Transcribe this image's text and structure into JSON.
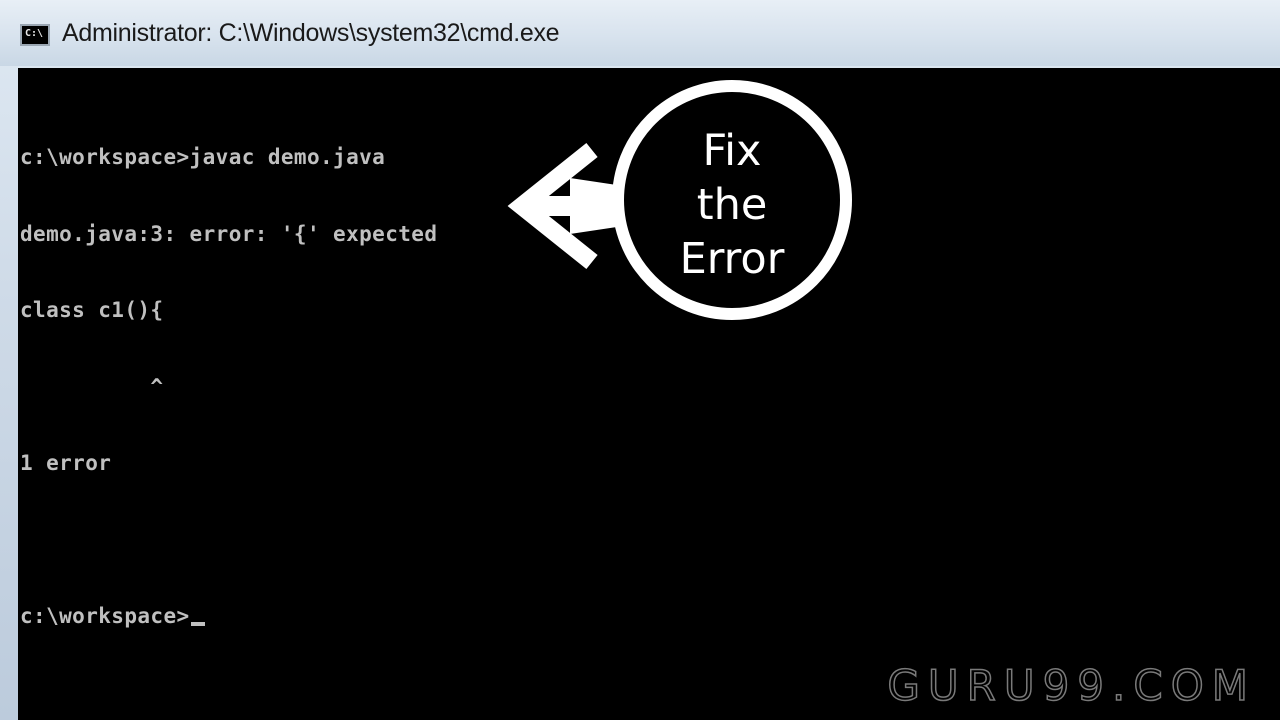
{
  "window": {
    "title": "Administrator: C:\\Windows\\system32\\cmd.exe",
    "icon": "cmd-icon",
    "icon_label": "C:\\"
  },
  "console": {
    "lines": [
      "c:\\workspace>javac demo.java",
      "demo.java:3: error: '{' expected",
      "class c1(){",
      "          ^",
      "1 error",
      "",
      "c:\\workspace>"
    ],
    "foreground": "#c0c0c0",
    "background": "#000000"
  },
  "annotation": {
    "lines": [
      "Fix",
      "the",
      "Error"
    ],
    "arrow_icon": "arrow-left-icon",
    "color": "#ffffff"
  },
  "watermark": {
    "text": "GURU99.COM"
  }
}
